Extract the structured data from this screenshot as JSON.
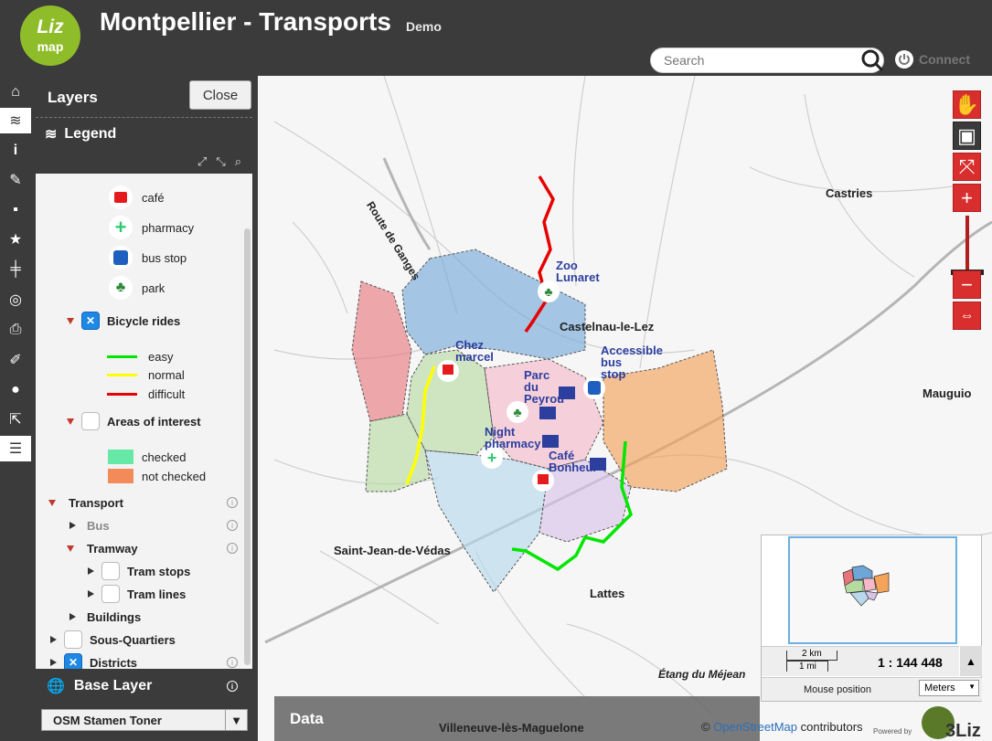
{
  "header": {
    "logo_top": "Liz",
    "logo_bottom": "map",
    "title": "Montpellier - Transports",
    "subtitle": "Demo",
    "search_placeholder": "Search",
    "connect_label": "Connect"
  },
  "mapbar": {
    "items": [
      "home-icon",
      "layers-icon",
      "info-icon",
      "edit-icon",
      "comment-icon",
      "star-icon",
      "measure-icon",
      "locate-icon",
      "print-icon",
      "draw-icon",
      "chat-icon",
      "share-icon",
      "list-icon"
    ],
    "active": "layers-icon"
  },
  "dock": {
    "layers_title": "Layers",
    "close_label": "Close",
    "legend_label": "Legend",
    "tree": {
      "symbols": [
        {
          "label": "café",
          "icon": "cafe-icon",
          "color": "#e41a1c"
        },
        {
          "label": "pharmacy",
          "icon": "pharmacy-icon",
          "color": "#2ecc71"
        },
        {
          "label": "bus stop",
          "icon": "bus-icon",
          "color": "#1f5fbf"
        },
        {
          "label": "park",
          "icon": "park-icon",
          "color": "#2e8b3a"
        }
      ],
      "bicycle": {
        "label": "Bicycle rides",
        "checked": true,
        "items": [
          {
            "label": "easy",
            "color": "#00e600"
          },
          {
            "label": "normal",
            "color": "#ffff00"
          },
          {
            "label": "difficult",
            "color": "#e60000"
          }
        ]
      },
      "areas": {
        "label": "Areas of interest",
        "checked": false,
        "items": [
          {
            "label": "checked",
            "color": "#66e8a6"
          },
          {
            "label": "not checked",
            "color": "#f28a5a"
          }
        ]
      },
      "transport": {
        "label": "Transport"
      },
      "bus": {
        "label": "Bus"
      },
      "tramway": {
        "label": "Tramway"
      },
      "tram_stops": {
        "label": "Tram stops"
      },
      "tram_lines": {
        "label": "Tram lines"
      },
      "buildings": {
        "label": "Buildings"
      },
      "sous_quartiers": {
        "label": "Sous-Quartiers"
      },
      "districts": {
        "label": "Districts"
      }
    },
    "base_layer_label": "Base Layer",
    "base_layer_value": "OSM Stamen Toner"
  },
  "map": {
    "labels": {
      "route": "Route de Ganges",
      "castries": "Castries",
      "castelnau": "Castelnau-le-Lez",
      "mauguio": "Mauguio",
      "saint_jean": "Saint-Jean-de-Védas",
      "lattes": "Lattes",
      "etang": "Étang du Méjean",
      "villeneuve": "Villeneuve-lès-Maguelone"
    },
    "pois": {
      "zoo": "Zoo\nLunaret",
      "chez": "Chez\nmarcel",
      "accessible": "Accessible\nbus\nstop",
      "parc": "Parc\ndu\nPeyrou",
      "night": "Night\npharmacy",
      "cafe": "Café\nBonheur"
    }
  },
  "overview": {
    "scale_km": "2 km",
    "scale_mi": "1 mi",
    "scale_ratio": "1 : 144 448",
    "mouse_position_label": "Mouse position",
    "units": "Meters"
  },
  "data_panel": {
    "label": "Data"
  },
  "attribution": {
    "prefix": "©",
    "link": "OpenStreetMap",
    "suffix": "contributors"
  },
  "powered_by": "Powered by",
  "brand_3liz": "3Liz"
}
